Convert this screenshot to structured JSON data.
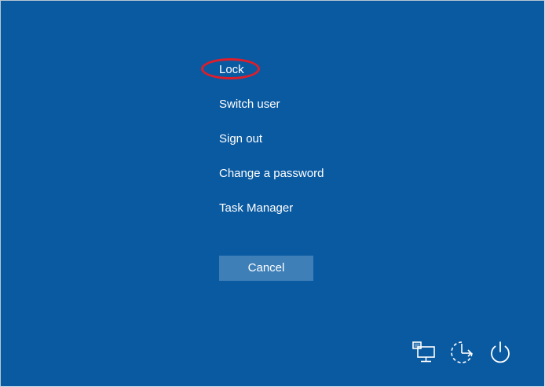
{
  "menu": {
    "items": [
      {
        "label": "Lock"
      },
      {
        "label": "Switch user"
      },
      {
        "label": "Sign out"
      },
      {
        "label": "Change a password"
      },
      {
        "label": "Task Manager"
      }
    ]
  },
  "cancel_label": "Cancel",
  "icons": {
    "network": "network-icon",
    "ease_of_access": "ease-of-access-icon",
    "power": "power-icon"
  },
  "colors": {
    "background": "#0a5aa1",
    "button": "#3e7fb8",
    "highlight": "#e01d2a",
    "text": "#ffffff"
  }
}
